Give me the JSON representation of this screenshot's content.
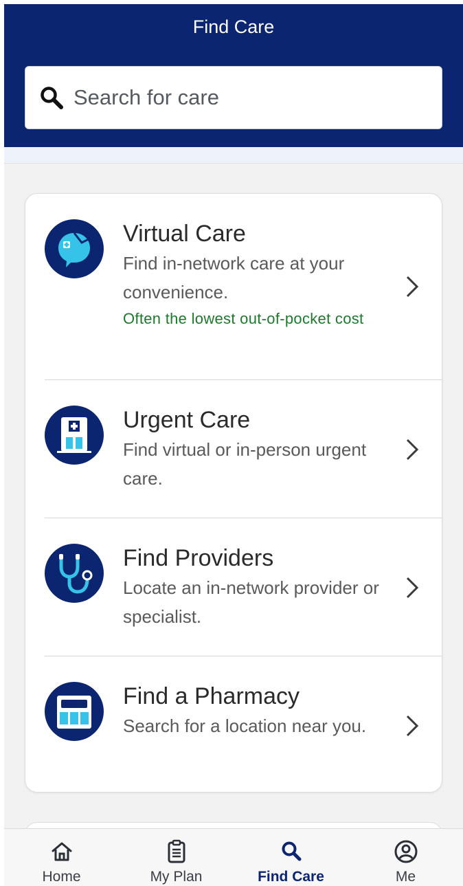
{
  "header": {
    "title": "Find Care",
    "background": "#0b2571"
  },
  "search": {
    "placeholder": "Search for care",
    "value": "",
    "icon": "magnifier-icon"
  },
  "care_options": [
    {
      "title": "Virtual Care",
      "description": "Find in-network care at your convenience.",
      "note": "Often the lowest out-of-pocket cost",
      "icon": "virtual-care-chat-icon"
    },
    {
      "title": "Urgent Care",
      "description": "Find virtual or in-person urgent care.",
      "icon": "hospital-building-icon"
    },
    {
      "title": "Find Providers",
      "description": "Locate an in-network provider or specialist.",
      "icon": "stethoscope-icon"
    },
    {
      "title": "Find a Pharmacy",
      "description": "Search for a location near you.",
      "icon": "pharmacy-storefront-icon"
    }
  ],
  "tabs": [
    {
      "label": "Home",
      "icon": "home-icon",
      "active": false
    },
    {
      "label": "My Plan",
      "icon": "clipboard-icon",
      "active": false
    },
    {
      "label": "Find Care",
      "icon": "search-icon",
      "active": true
    },
    {
      "label": "Me",
      "icon": "user-circle-icon",
      "active": false
    }
  ],
  "colors": {
    "accent_navy": "#0b2571",
    "icon_teal": "#35c3e9",
    "note_green": "#1c7a2a"
  }
}
